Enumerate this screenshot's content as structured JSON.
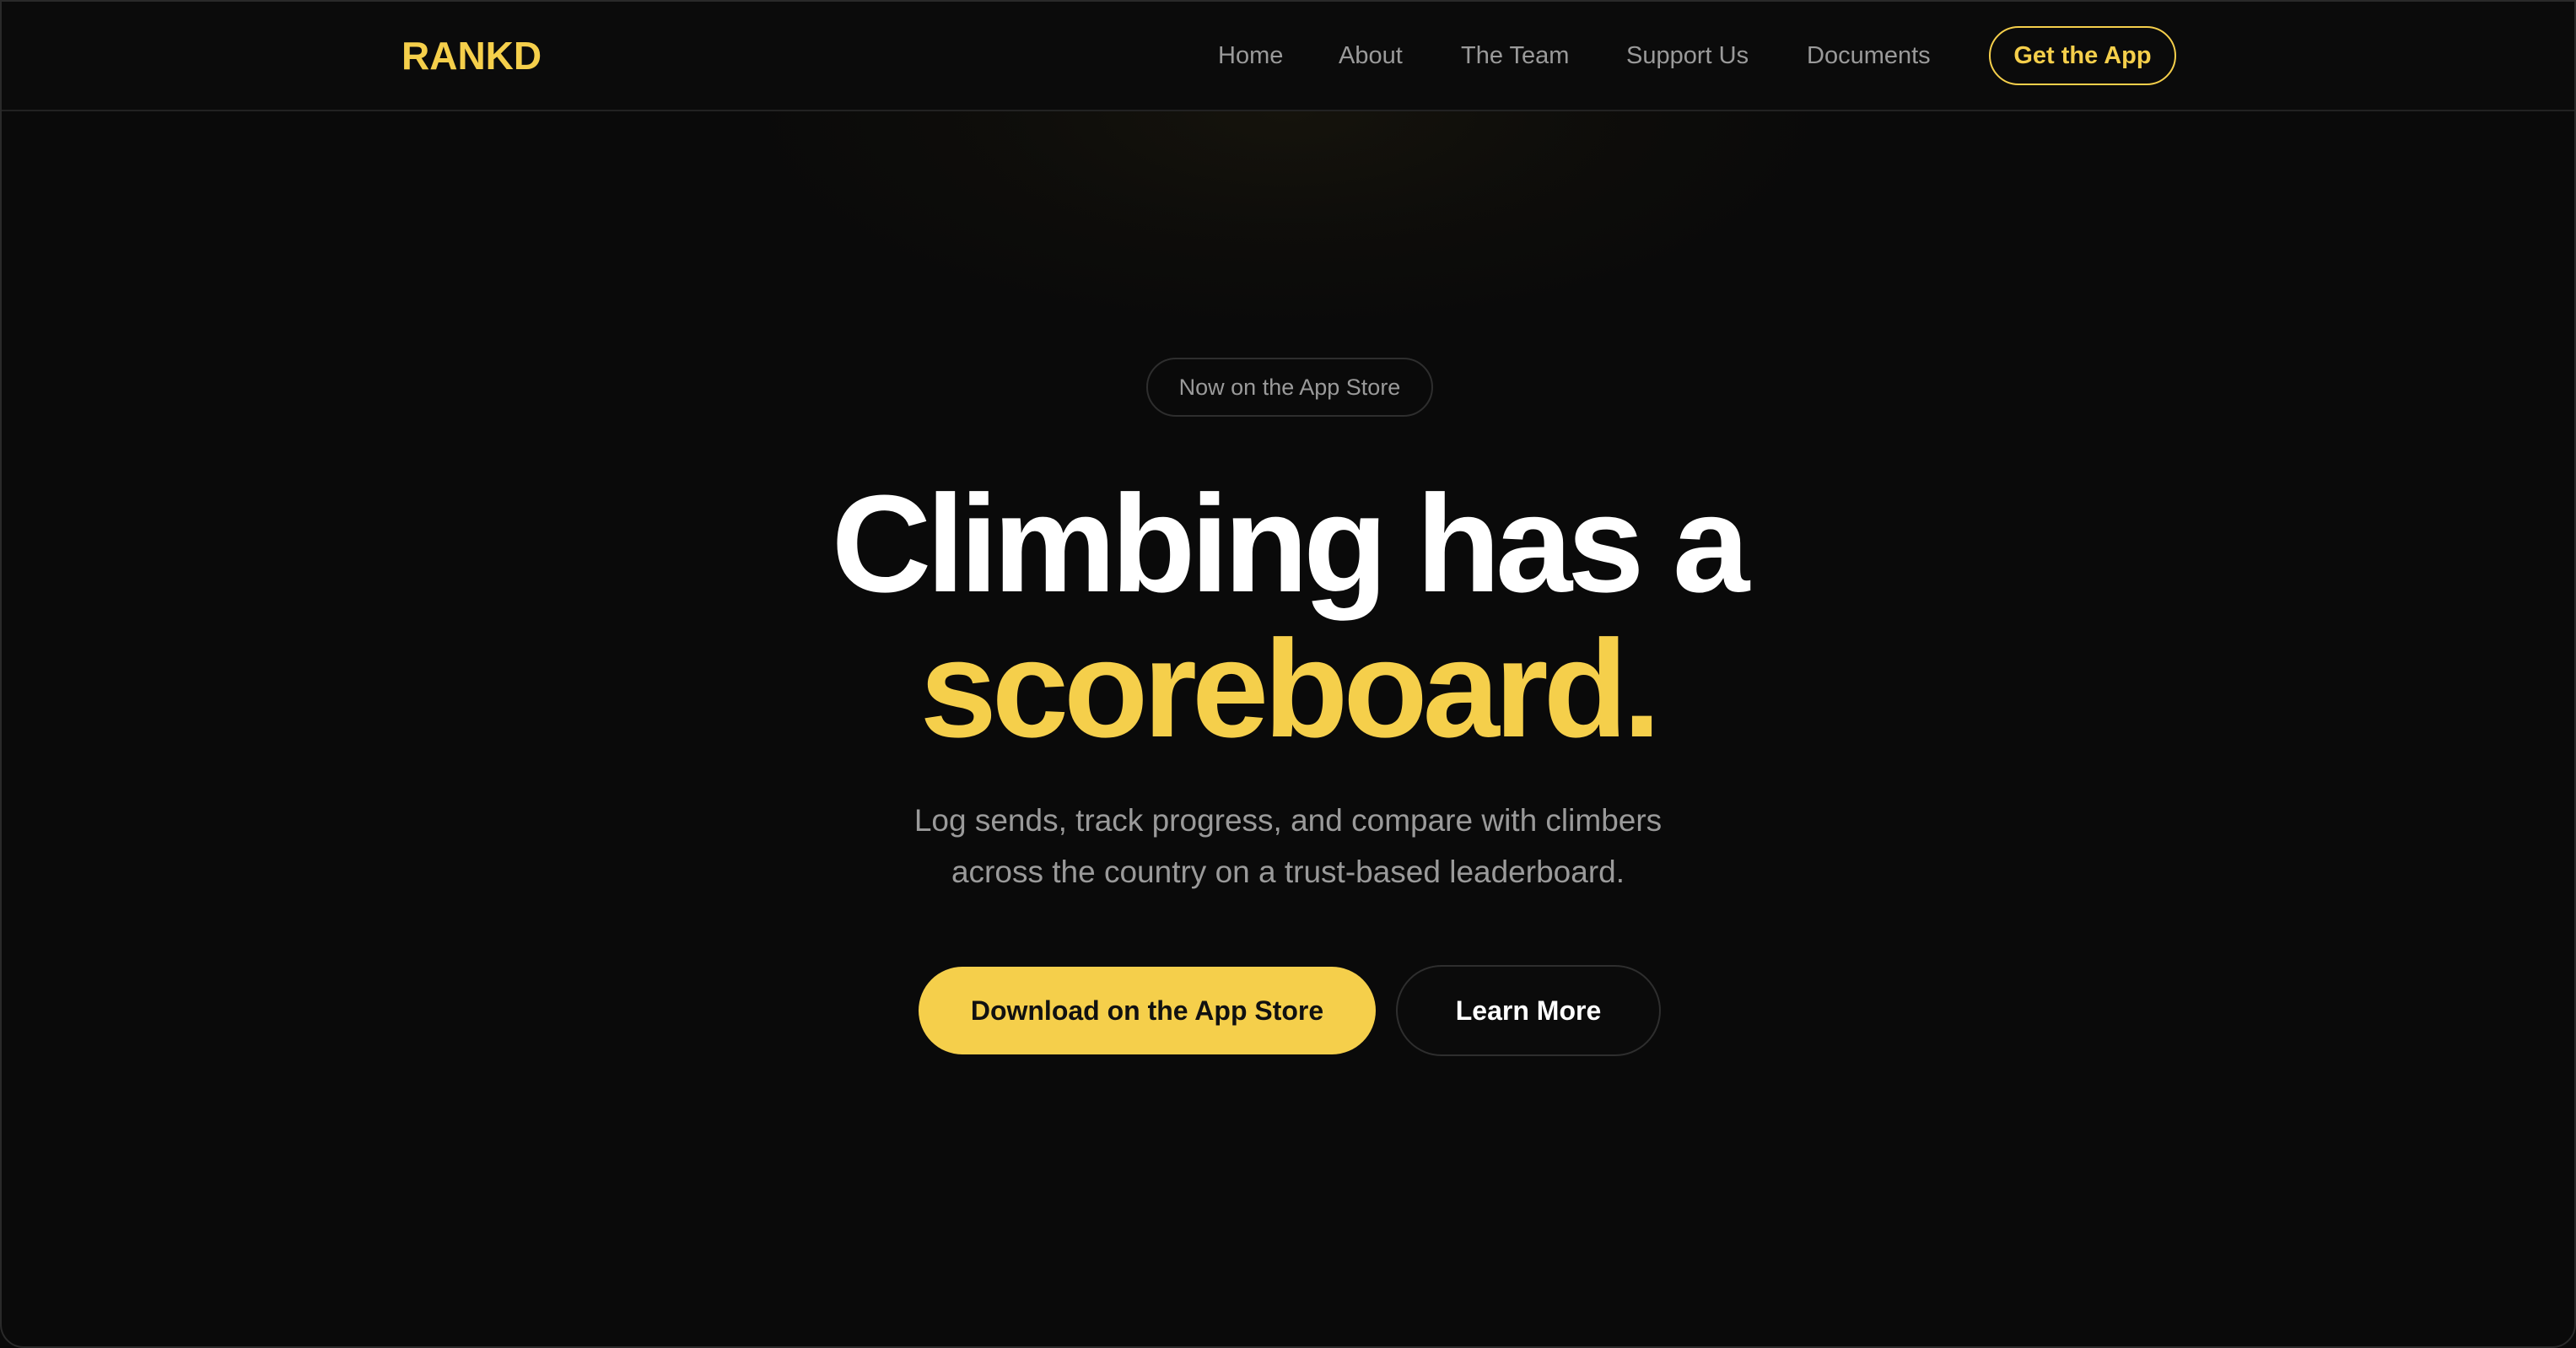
{
  "brand": {
    "logo": "RANKD",
    "accent_color": "#f5cf4b",
    "background_color": "#0a0a0a"
  },
  "nav": {
    "links": [
      {
        "label": "Home"
      },
      {
        "label": "About"
      },
      {
        "label": "The Team"
      },
      {
        "label": "Support Us"
      },
      {
        "label": "Documents"
      }
    ],
    "cta_label": "Get the App"
  },
  "hero": {
    "badge": "Now on the App Store",
    "headline_line1": "Climbing has a",
    "headline_line2": "scoreboard.",
    "subtitle_line1": "Log sends, track progress, and compare with climbers",
    "subtitle_line2": "across the country on a trust-based leaderboard.",
    "primary_button": "Download on the App Store",
    "secondary_button": "Learn More"
  }
}
